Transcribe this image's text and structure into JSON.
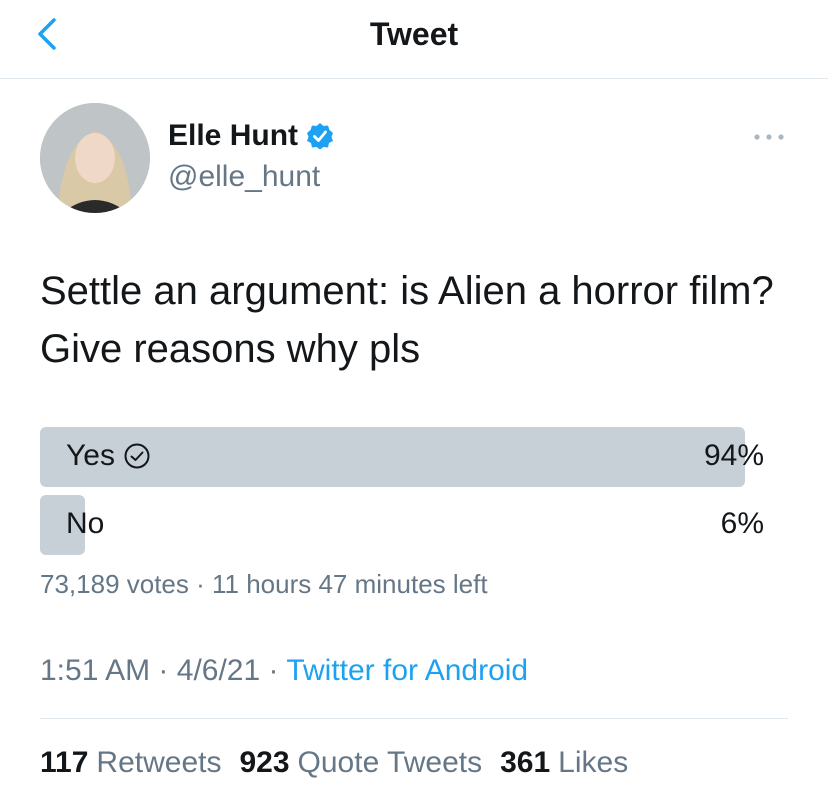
{
  "header": {
    "title": "Tweet"
  },
  "author": {
    "name": "Elle Hunt",
    "handle": "@elle_hunt"
  },
  "tweet": {
    "text": "Settle an argument: is Alien a horror film? Give reasons why pls"
  },
  "poll": {
    "options": [
      {
        "label": "Yes",
        "percent": "94%",
        "value": 0.94,
        "selected": true
      },
      {
        "label": "No",
        "percent": "6%",
        "value": 0.06,
        "selected": false
      }
    ],
    "summary": "73,189 votes · 11 hours 47 minutes left"
  },
  "details": {
    "time": "1:51 AM",
    "date": "4/6/21",
    "app": "Twitter for Android",
    "sep": "·"
  },
  "stats": {
    "retweets": {
      "count": "117",
      "label": "Retweets"
    },
    "quotes": {
      "count": "923",
      "label": "Quote Tweets"
    },
    "likes": {
      "count": "361",
      "label": "Likes"
    }
  },
  "colors": {
    "accent": "#1da1f2",
    "poll_bar": "#c8d0d7",
    "muted": "#657786"
  }
}
